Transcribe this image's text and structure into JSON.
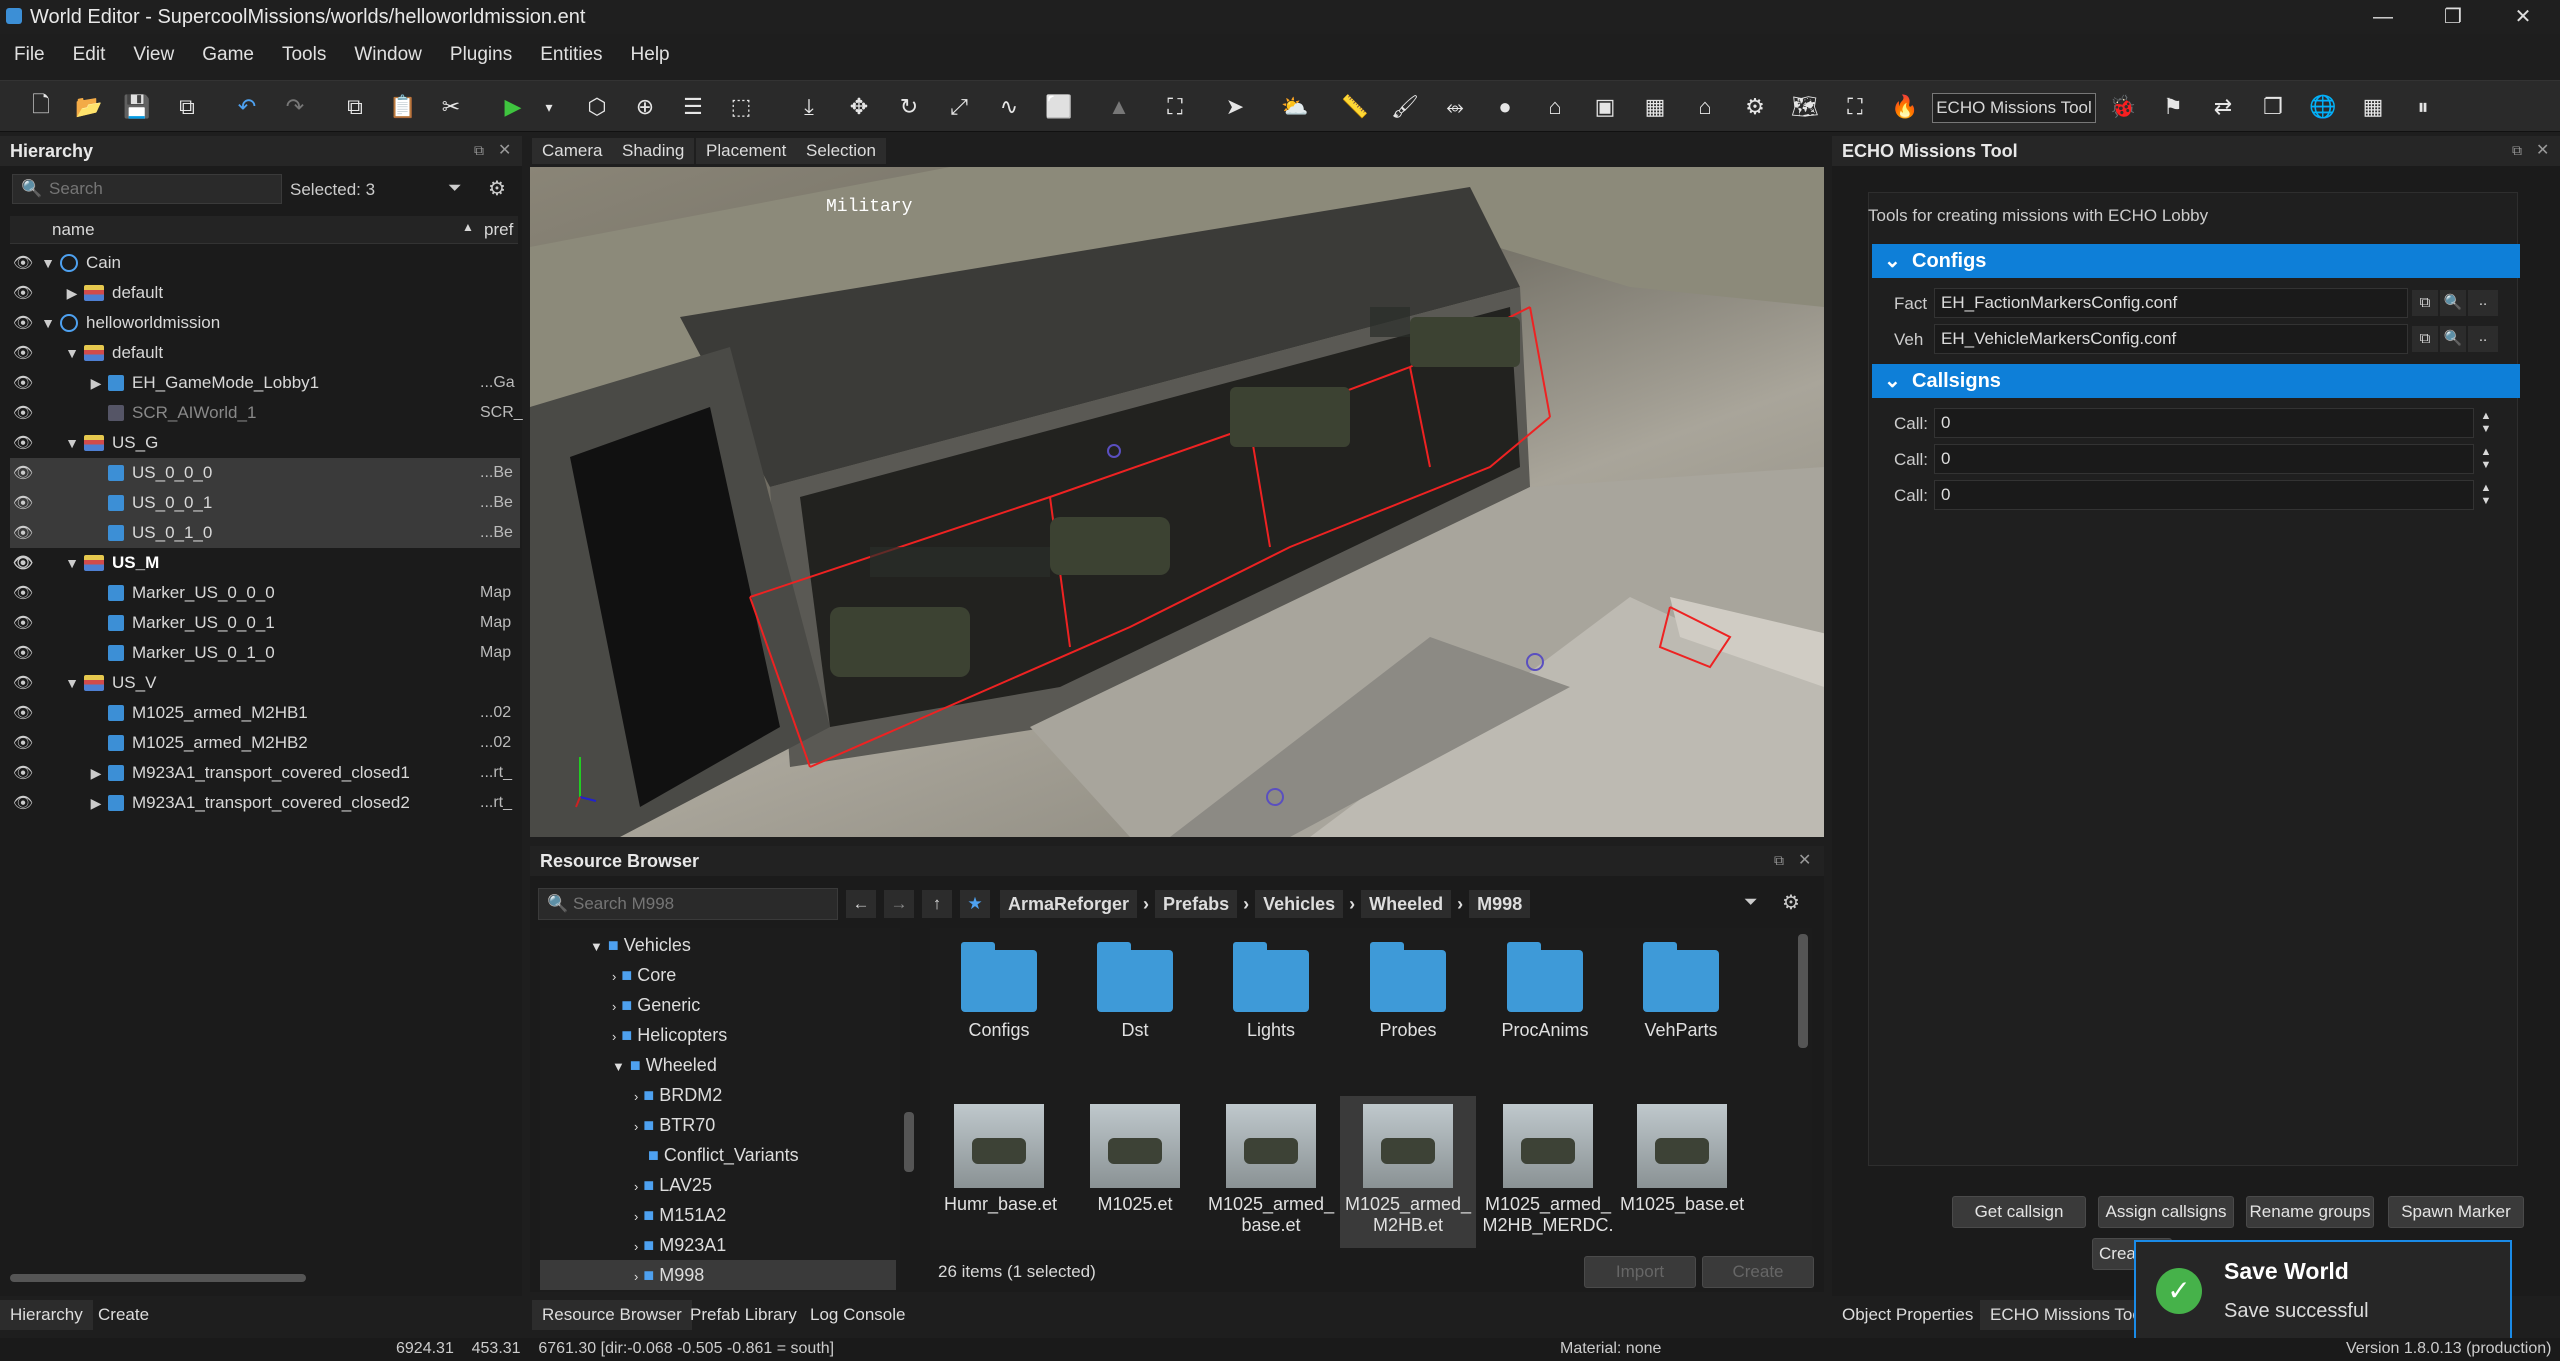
{
  "window": {
    "title": "World Editor - SupercoolMissions/worlds/helloworldmission.ent",
    "minimize": "—",
    "maximize": "❐",
    "close": "✕"
  },
  "menu": [
    "File",
    "Edit",
    "View",
    "Game",
    "Tools",
    "Window",
    "Plugins",
    "Entities",
    "Help"
  ],
  "toolbar": {
    "echo_tool_label": "ECHO Missions Tool"
  },
  "hierarchy": {
    "title": "Hierarchy",
    "search_placeholder": "Search",
    "selected": "Selected: 3",
    "col_name": "name",
    "col_pref": "pref",
    "rows": [
      {
        "name": "Cain",
        "pref": ""
      },
      {
        "name": "default",
        "pref": ""
      },
      {
        "name": "helloworldmission",
        "pref": ""
      },
      {
        "name": "default",
        "pref": ""
      },
      {
        "name": "EH_GameMode_Lobby1",
        "pref": "...Ga"
      },
      {
        "name": "SCR_AIWorld_1",
        "pref": "SCR_"
      },
      {
        "name": "US_G",
        "pref": ""
      },
      {
        "name": "US_0_0_0",
        "pref": "...Be"
      },
      {
        "name": "US_0_0_1",
        "pref": "...Be"
      },
      {
        "name": "US_0_1_0",
        "pref": "...Be"
      },
      {
        "name": "US_M",
        "pref": ""
      },
      {
        "name": "Marker_US_0_0_0",
        "pref": "Map"
      },
      {
        "name": "Marker_US_0_0_1",
        "pref": "Map"
      },
      {
        "name": "Marker_US_0_1_0",
        "pref": "Map"
      },
      {
        "name": "US_V",
        "pref": ""
      },
      {
        "name": "M1025_armed_M2HB1",
        "pref": "...02"
      },
      {
        "name": "M1025_armed_M2HB2",
        "pref": "...02"
      },
      {
        "name": "M923A1_transport_covered_closed1",
        "pref": "...rt_"
      },
      {
        "name": "M923A1_transport_covered_closed2",
        "pref": "...rt_"
      }
    ],
    "tabs": [
      "Hierarchy",
      "Create"
    ]
  },
  "viewport": {
    "tabs": [
      "Camera",
      "Shading",
      "Placement",
      "Selection"
    ],
    "overlay_text": "Military"
  },
  "resource_browser": {
    "title": "Resource Browser",
    "search_placeholder": "Search M998",
    "breadcrumb": [
      "ArmaReforger",
      "Prefabs",
      "Vehicles",
      "Wheeled",
      "M998"
    ],
    "tree": [
      "Vehicles",
      "Core",
      "Generic",
      "Helicopters",
      "Wheeled",
      "BRDM2",
      "BTR70",
      "Conflict_Variants",
      "LAV25",
      "M151A2",
      "M923A1",
      "M998"
    ],
    "folders": [
      "Configs",
      "Dst",
      "Lights",
      "Probes",
      "ProcAnims",
      "VehParts"
    ],
    "files": [
      "Humr_base.et",
      "M1025.et",
      "M1025_armed_\nbase.et",
      "M1025_armed_\nM2HB.et",
      "M1025_armed_\nM2HB_MERDC.",
      "M1025_base.et"
    ],
    "count": "26 items (1 selected)",
    "import": "Import",
    "create": "Create"
  },
  "bottom_tabs": [
    "Resource Browser",
    "Prefab Library",
    "Log Console"
  ],
  "echo": {
    "title": "ECHO Missions Tool",
    "description": "Tools for creating missions with ECHO Lobby",
    "configs_label": "Configs",
    "fact_label": "Fact",
    "fact_value": "EH_FactionMarkersConfig.conf",
    "veh_label": "Veh",
    "veh_value": "EH_VehicleMarkersConfig.conf",
    "callsigns_label": "Callsigns",
    "call_label": "Call:",
    "call_values": [
      "0",
      "0",
      "0"
    ],
    "buttons": [
      "Get callsign",
      "Assign callsigns",
      "Rename groups",
      "Spawn Marker"
    ],
    "create_partial": "Crea",
    "tabs": [
      "Object Properties",
      "ECHO Missions Tool"
    ]
  },
  "toast": {
    "title": "Save World",
    "message": "Save successful"
  },
  "status": {
    "coords": "6924.31    453.31    6761.30 [dir:-0.068 -0.505 -0.861 = south]",
    "material": "Material: none",
    "version": "Version 1.8.0.13 (production)"
  }
}
